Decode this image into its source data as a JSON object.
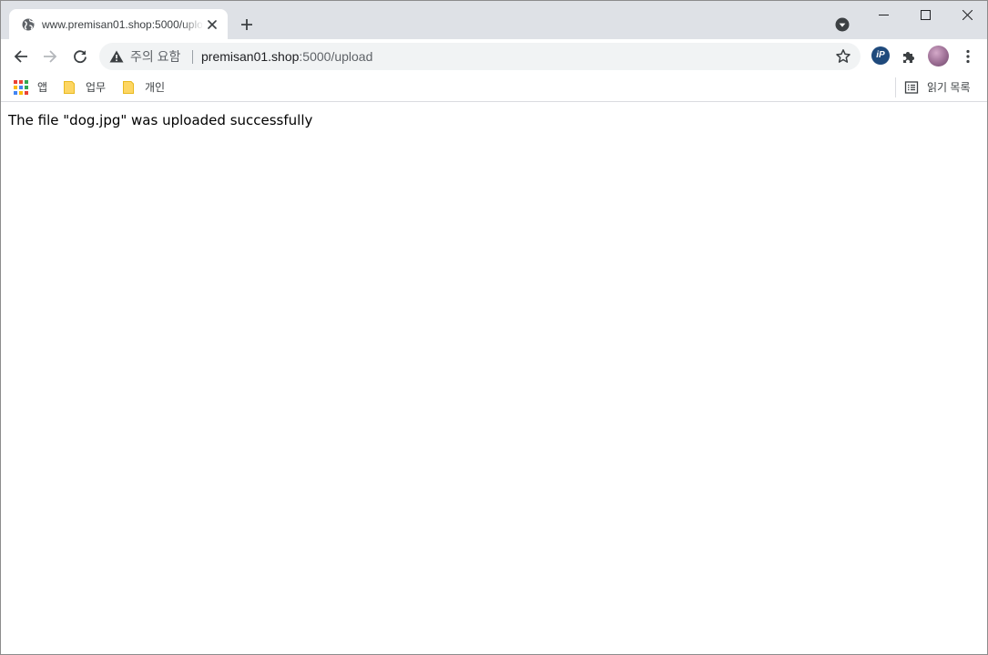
{
  "tab": {
    "title": "www.premisan01.shop:5000/upload",
    "favicon": "globe-icon"
  },
  "toolbar": {
    "security_label": "주의 요함",
    "url_host": "premisan01.shop",
    "url_rest": ":5000/upload",
    "extension_ip_label": "iP"
  },
  "bookmarks": {
    "items": [
      {
        "label": "앱",
        "icon": "apps-grid-icon"
      },
      {
        "label": "업무",
        "icon": "folder-icon"
      },
      {
        "label": "개인",
        "icon": "folder-icon"
      }
    ],
    "reading_list_label": "읽기 목록"
  },
  "page": {
    "message": "The file \"dog.jpg\" was uploaded successfully"
  },
  "colors": {
    "tabstrip": "#dee1e6",
    "omnibox": "#f1f3f4",
    "folder": "#fdd663",
    "ext_ip": "#1f4a7c"
  }
}
